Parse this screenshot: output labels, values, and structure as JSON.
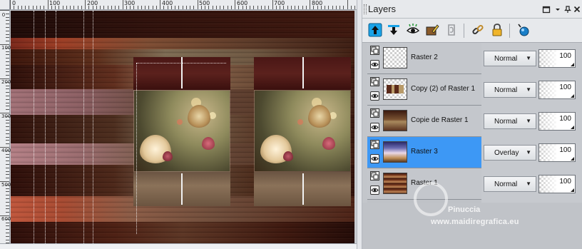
{
  "ruler": {
    "top_labels": [
      "0",
      "100",
      "200",
      "300",
      "400",
      "500",
      "600",
      "700",
      "800"
    ],
    "left_labels": [
      "0",
      "100",
      "200",
      "300",
      "400",
      "500",
      "600"
    ]
  },
  "palette": {
    "title": "Layers",
    "title_buttons": [
      "restore-icon",
      "pin-icon",
      "close-icon"
    ],
    "toolbar": [
      "move-layer-up-icon",
      "move-layer-down-icon",
      "visibility-toggle-icon",
      "edit-selection-icon",
      "protect-transparency-icon",
      "link-icon",
      "lock-icon",
      "new-layer-icon"
    ]
  },
  "layers": [
    {
      "name": "Raster 2",
      "blend": "Normal",
      "opacity": "100",
      "selected": false,
      "thumb": "checker"
    },
    {
      "name": "Copy (2) of Raster 1",
      "blend": "Normal",
      "opacity": "100",
      "selected": false,
      "thumb": "checker-strip"
    },
    {
      "name": "Copie de Raster 1",
      "blend": "Normal",
      "opacity": "100",
      "selected": false,
      "thumb": "brown"
    },
    {
      "name": "Raster 3",
      "blend": "Overlay",
      "opacity": "100",
      "selected": true,
      "thumb": "gradient"
    },
    {
      "name": "Raster 1",
      "blend": "Normal",
      "opacity": "100",
      "selected": false,
      "thumb": "striped"
    }
  ],
  "watermark": {
    "name": "Pinuccia",
    "url": "www.maidiregrafica.eu"
  },
  "colors": {
    "selection": "#3d98f5",
    "accent_up": "#1aa3e8"
  }
}
